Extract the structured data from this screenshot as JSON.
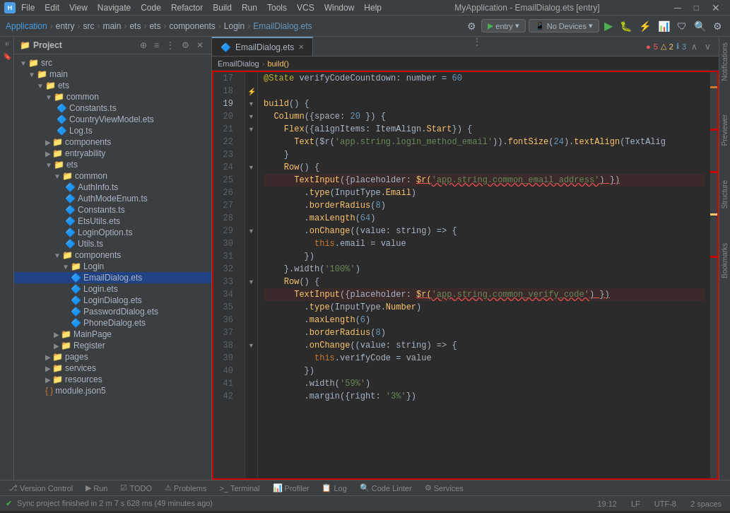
{
  "app": {
    "title": "MyApplication - EmailDialog.ets [entry]",
    "window_controls": [
      "minimize",
      "maximize",
      "close"
    ]
  },
  "menu": {
    "items": [
      "File",
      "Edit",
      "View",
      "Navigate",
      "Code",
      "Refactor",
      "Build",
      "Run",
      "Tools",
      "VCS",
      "Window",
      "Help"
    ]
  },
  "toolbar": {
    "breadcrumbs": [
      "Application",
      "entry",
      "src",
      "main",
      "ets",
      "ets",
      "components",
      "Login",
      "EmailDialog.ets"
    ],
    "config_btn": "entry",
    "devices_btn": "No Devices",
    "sync_icon": "⚙",
    "run_icon": "▶",
    "debug_icon": "🐛"
  },
  "project_panel": {
    "title": "Project",
    "tree": [
      {
        "id": "src",
        "label": "src",
        "type": "folder",
        "indent": 1,
        "expanded": true
      },
      {
        "id": "main",
        "label": "main",
        "type": "folder",
        "indent": 2,
        "expanded": true
      },
      {
        "id": "ets",
        "label": "ets",
        "type": "folder",
        "indent": 3,
        "expanded": true
      },
      {
        "id": "common",
        "label": "common",
        "type": "folder",
        "indent": 4,
        "expanded": true
      },
      {
        "id": "Constants.ts",
        "label": "Constants.ts",
        "type": "file-ets",
        "indent": 5
      },
      {
        "id": "CountryViewModel.ets",
        "label": "CountryViewModel.ets",
        "type": "file-ets",
        "indent": 5
      },
      {
        "id": "Log.ts",
        "label": "Log.ts",
        "type": "file-ets",
        "indent": 5
      },
      {
        "id": "components",
        "label": "components",
        "type": "folder",
        "indent": 4,
        "expanded": false
      },
      {
        "id": "entryability",
        "label": "entryability",
        "type": "folder",
        "indent": 4,
        "expanded": false
      },
      {
        "id": "ets2",
        "label": "ets",
        "type": "folder",
        "indent": 4,
        "expanded": true
      },
      {
        "id": "common2",
        "label": "common",
        "type": "folder",
        "indent": 5,
        "expanded": true
      },
      {
        "id": "AuthInfo.ts",
        "label": "AuthInfo.ts",
        "type": "file-ets",
        "indent": 6
      },
      {
        "id": "AuthModeEnum.ts",
        "label": "AuthModeEnum.ts",
        "type": "file-ets",
        "indent": 6
      },
      {
        "id": "Constants2.ts",
        "label": "Constants.ts",
        "type": "file-ets",
        "indent": 6
      },
      {
        "id": "EtsUtils.ets",
        "label": "EtsUtils.ets",
        "type": "file-ets",
        "indent": 6
      },
      {
        "id": "LoginOption.ts",
        "label": "LoginOption.ts",
        "type": "file-ets",
        "indent": 6
      },
      {
        "id": "Utils.ts",
        "label": "Utils.ts",
        "type": "file-ets",
        "indent": 6
      },
      {
        "id": "components2",
        "label": "components",
        "type": "folder",
        "indent": 5,
        "expanded": true
      },
      {
        "id": "Login",
        "label": "Login",
        "type": "folder",
        "indent": 6,
        "expanded": true
      },
      {
        "id": "EmailDialog.ets",
        "label": "EmailDialog.ets",
        "type": "file-ets",
        "indent": 7,
        "selected": true
      },
      {
        "id": "Login.ets",
        "label": "Login.ets",
        "type": "file-ets",
        "indent": 7
      },
      {
        "id": "LoginDialog.ets",
        "label": "LoginDialog.ets",
        "type": "file-ets",
        "indent": 7
      },
      {
        "id": "PasswordDialog.ets",
        "label": "PasswordDialog.ets",
        "type": "file-ets",
        "indent": 7
      },
      {
        "id": "PhoneDialog.ets",
        "label": "PhoneDialog.ets",
        "type": "file-ets",
        "indent": 7
      },
      {
        "id": "MainPage",
        "label": "MainPage",
        "type": "folder",
        "indent": 5,
        "expanded": false
      },
      {
        "id": "Register",
        "label": "Register",
        "type": "folder",
        "indent": 5,
        "expanded": false
      },
      {
        "id": "pages",
        "label": "pages",
        "type": "folder",
        "indent": 4,
        "expanded": false
      },
      {
        "id": "services",
        "label": "services",
        "type": "folder",
        "indent": 4,
        "expanded": false
      },
      {
        "id": "resources",
        "label": "resources",
        "type": "folder",
        "indent": 4,
        "expanded": false
      },
      {
        "id": "module.json5",
        "label": "module.json5",
        "type": "file-json",
        "indent": 4
      }
    ]
  },
  "editor": {
    "tab_label": "EmailDialog.ets",
    "breadcrumb": [
      "EmailDialog",
      "build()"
    ],
    "error_count": "5",
    "warn_count": "2",
    "info_count": "3",
    "lines": [
      {
        "num": 17,
        "content": "@State verifyCodeCountdown: number = 60",
        "indent": 4,
        "has_fold": false
      },
      {
        "num": 18,
        "content": "",
        "indent": 0
      },
      {
        "num": 19,
        "content": "build() {",
        "indent": 2,
        "has_fold": true
      },
      {
        "num": 20,
        "content": "  Column({ space: 20 }) {",
        "indent": 4,
        "has_fold": true
      },
      {
        "num": 21,
        "content": "    Flex({ alignItems: ItemAlign.Start}) {",
        "indent": 6,
        "has_fold": true
      },
      {
        "num": 22,
        "content": "      Text($r('app.string.login_method_email')).fontSize(24).textAlign(TextAlig",
        "indent": 8
      },
      {
        "num": 23,
        "content": "    }",
        "indent": 4
      },
      {
        "num": 24,
        "content": "    Row() {",
        "indent": 4,
        "has_fold": true
      },
      {
        "num": 25,
        "content": "      TextInput({ placeholder: $r('app.string.common_email_address') })",
        "indent": 6,
        "err": true
      },
      {
        "num": 26,
        "content": "        .type(InputType.Email)",
        "indent": 8
      },
      {
        "num": 27,
        "content": "        .borderRadius(8)",
        "indent": 8
      },
      {
        "num": 28,
        "content": "        .maxLength(64)",
        "indent": 8
      },
      {
        "num": 29,
        "content": "        .onChange((value: string) => {",
        "indent": 8,
        "has_fold": true
      },
      {
        "num": 30,
        "content": "          this.email = value",
        "indent": 10
      },
      {
        "num": 31,
        "content": "        })",
        "indent": 8
      },
      {
        "num": 32,
        "content": "    }.width('100%')",
        "indent": 4
      },
      {
        "num": 33,
        "content": "    Row() {",
        "indent": 4,
        "has_fold": true
      },
      {
        "num": 34,
        "content": "      TextInput({ placeholder: $r('app.string.common_verify_code') })",
        "indent": 6,
        "err": true
      },
      {
        "num": 35,
        "content": "        .type(InputType.Number)",
        "indent": 8
      },
      {
        "num": 36,
        "content": "        .maxLength(6)",
        "indent": 8
      },
      {
        "num": 37,
        "content": "        .borderRadius(8)",
        "indent": 8
      },
      {
        "num": 38,
        "content": "        .onChange((value: string) => {",
        "indent": 8,
        "has_fold": true
      },
      {
        "num": 39,
        "content": "          this.verifyCode = value",
        "indent": 10
      },
      {
        "num": 40,
        "content": "        })",
        "indent": 8
      },
      {
        "num": 41,
        "content": "        .width('59%')",
        "indent": 8
      },
      {
        "num": 42,
        "content": "        .margin({ right: '3%'})",
        "indent": 8
      }
    ]
  },
  "bottom_tabs": [
    {
      "label": "Version Control",
      "icon": "⎇",
      "active": false
    },
    {
      "label": "Run",
      "icon": "▶",
      "active": false
    },
    {
      "label": "TODO",
      "icon": "☑",
      "active": false
    },
    {
      "label": "Problems",
      "icon": "⚠",
      "active": false
    },
    {
      "label": "Terminal",
      "icon": ">_",
      "active": false
    },
    {
      "label": "Profiler",
      "icon": "📊",
      "active": false
    },
    {
      "label": "Log",
      "icon": "📋",
      "active": false
    },
    {
      "label": "Code Linter",
      "icon": "🔍",
      "active": false
    },
    {
      "label": "Services",
      "icon": "⚙",
      "active": false
    }
  ],
  "status_bar": {
    "sync_message": "Sync project finished in 2 m 7 s 628 ms (49 minutes ago)",
    "line_col": "19:12",
    "encoding": "UTF-8",
    "line_ending": "LF",
    "indent": "2 spaces"
  },
  "right_panels": {
    "notifications": "Notifications",
    "previewer": "Previewer",
    "structure": "Structure",
    "bookmarks": "Bookmarks"
  }
}
